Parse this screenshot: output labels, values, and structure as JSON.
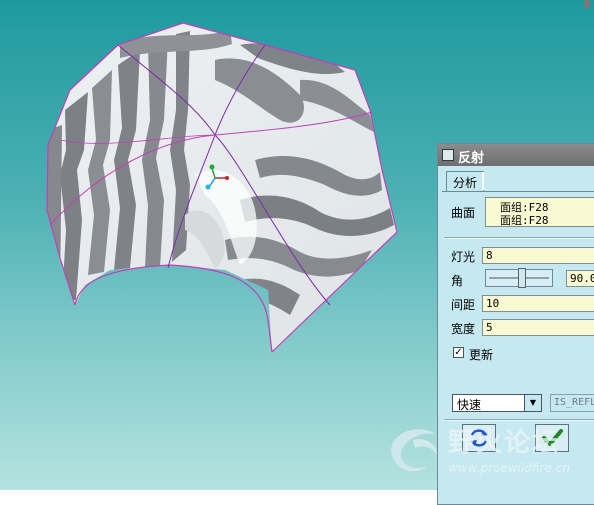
{
  "dialog": {
    "title": "反射",
    "tab_analysis": "分析",
    "surface_label": "曲面",
    "surface_items": [
      "面组:F28",
      "面组:F28"
    ],
    "light_label": "灯光",
    "light_value": "8",
    "angle_label": "角",
    "angle_value": "90.0",
    "spacing_label": "间距",
    "spacing_value": "10",
    "width_label": "宽度",
    "width_value": "5",
    "update_label": "更新",
    "update_checked": true,
    "mode_value": "快速",
    "feature_name": "IS_REFL"
  },
  "watermark": {
    "text": "野火论坛",
    "url": "www.proewildfire.cn"
  },
  "icons": {
    "dialog": "window-icon",
    "repaint": "repaint-icon",
    "ok": "checkmark-icon",
    "dropdown": "chevron-down-icon"
  },
  "colors": {
    "viewport_top": "#1e9a9e",
    "viewport_bottom": "#b4e2df",
    "dialog_bg": "#c6e8f0",
    "field_bg": "#fafad2",
    "titlebar": "#7d7d7d",
    "surface_edge": "#c23fb8"
  }
}
